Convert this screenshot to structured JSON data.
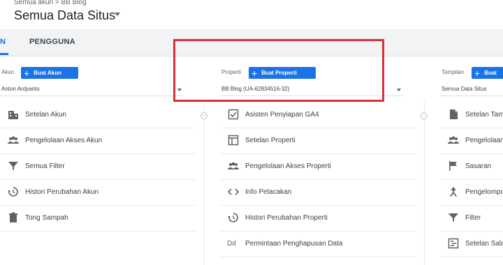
{
  "header": {
    "breadcrumb": "Semua akun > BB Blog",
    "title": "Semua Data Situs"
  },
  "tabs": [
    {
      "label": "N",
      "active": true
    },
    {
      "label": "PENGGUNA",
      "active": false
    }
  ],
  "columns": {
    "account": {
      "label": "Akun",
      "create_button": "Buat Akun",
      "selected": "Anton Ardyanto",
      "items": [
        {
          "label": "Setelan Akun",
          "icon": "building-icon"
        },
        {
          "label": "Pengelolaan Akses Akun",
          "icon": "people-icon"
        },
        {
          "label": "Semua Filter",
          "icon": "filter-icon"
        },
        {
          "label": "Histori Perubahan Akun",
          "icon": "history-icon"
        },
        {
          "label": "Tong Sampah",
          "icon": "trash-icon"
        }
      ]
    },
    "property": {
      "label": "Properti",
      "create_button": "Buat Properti",
      "selected": "BB Blog (UA-62834516-32)",
      "items": [
        {
          "label": "Asisten Penyiapan GA4",
          "icon": "checkbox-icon"
        },
        {
          "label": "Setelan Properti",
          "icon": "layout-icon"
        },
        {
          "label": "Pengelolaan Akses Properti",
          "icon": "people-icon"
        },
        {
          "label": "Info Pelacakan",
          "icon": "code-icon"
        },
        {
          "label": "Histori Perubahan Properti",
          "icon": "history-icon"
        },
        {
          "label": "Permintaan Penghapusan Data",
          "icon": "dd-icon",
          "icon_text": "Dd"
        }
      ]
    },
    "view": {
      "label": "Tampilan",
      "create_button": "Buat",
      "selected": "Semua Data Situs",
      "items": [
        {
          "label": "Setelan Tam",
          "icon": "document-icon"
        },
        {
          "label": "Pengelolaan",
          "icon": "people-icon"
        },
        {
          "label": "Sasaran",
          "icon": "flag-icon"
        },
        {
          "label": "Pengelompo",
          "icon": "grouping-icon"
        },
        {
          "label": "Filter",
          "icon": "filter-icon"
        },
        {
          "label": "Setelan Salu",
          "icon": "channel-icon"
        }
      ]
    }
  },
  "colors": {
    "accent": "#1a73e8",
    "highlight": "#d93038",
    "icon": "#5f6368"
  }
}
